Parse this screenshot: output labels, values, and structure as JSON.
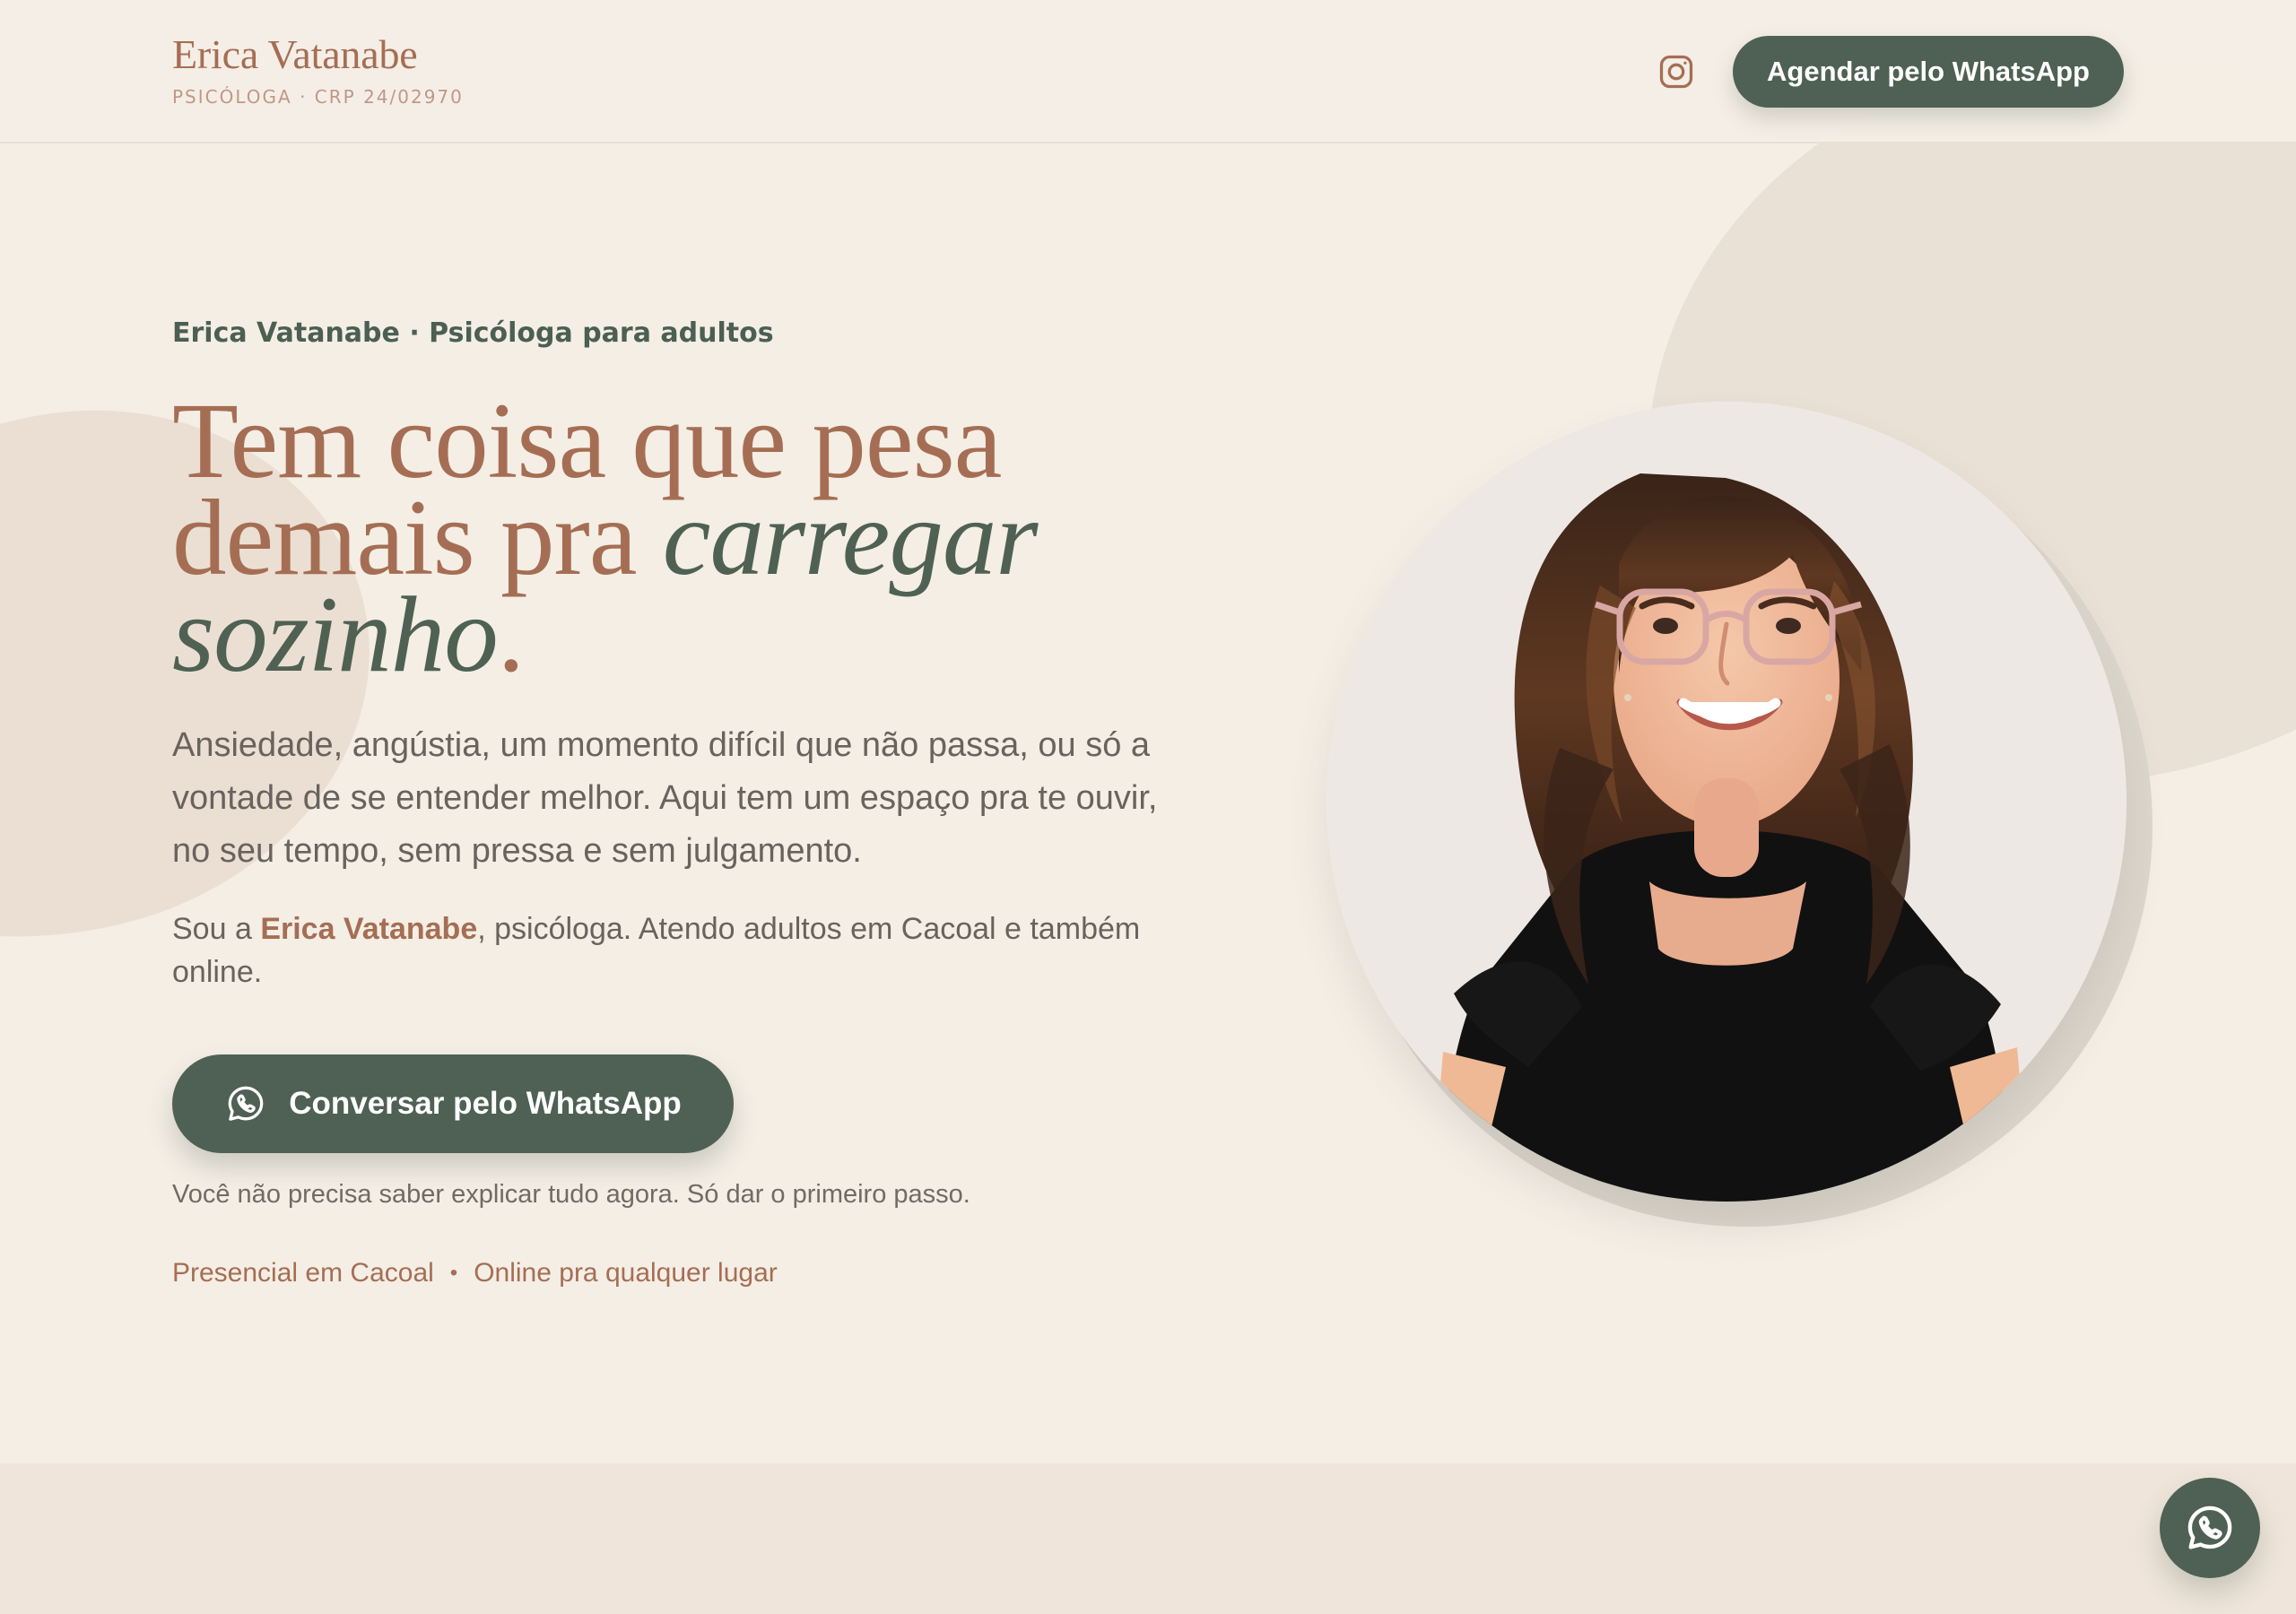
{
  "header": {
    "brand_name": "Erica Vatanabe",
    "brand_subtitle": "PSICÓLOGA · CRP 24/02970",
    "instagram_icon": "instagram-icon",
    "schedule_button_label": "Agendar pelo WhatsApp"
  },
  "hero": {
    "eyebrow": "Erica Vatanabe · Psicóloga para adultos",
    "headline": {
      "line_1": "Tem coisa que pesa",
      "line_2_start": "demais pra ",
      "line_2_accent": "carregar",
      "line_3_accent": "sozinho",
      "line_3_end": "."
    },
    "intro": "Ansiedade, angústia, um momento difícil que não passa, ou só a vontade de se entender melhor. Aqui tem um espaço pra te ouvir, no seu tempo, sem pressa e sem julgamento.",
    "bio": {
      "prefix": "Sou a ",
      "name": "Erica Vatanabe",
      "suffix": ", psicóloga. Atendo adultos em Cacoal e também online."
    },
    "chat_button": {
      "label": "Conversar pelo WhatsApp",
      "icon": "whatsapp-icon"
    },
    "helper_text": "Você não precisa saber explicar tudo agora. Só dar o primeiro passo.",
    "service_options": [
      "Presencial em Cacoal",
      "Online pra qualquer lugar"
    ],
    "service_separator": "•"
  },
  "floating_action": {
    "icon": "whatsapp-icon"
  },
  "colors": {
    "background": "#f4eee5",
    "terracotta": "#a56e54",
    "forest_green": "#4e6154",
    "body_text": "#6a625d",
    "soft_blob": "#ebdfd3"
  }
}
